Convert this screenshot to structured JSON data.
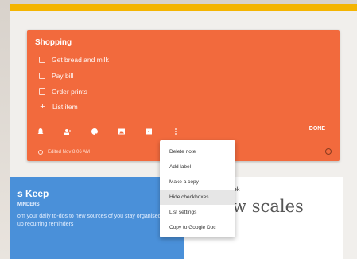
{
  "note": {
    "title": "Shopping",
    "items": [
      {
        "label": "Get bread and milk"
      },
      {
        "label": "Pay bill"
      },
      {
        "label": "Order prints"
      }
    ],
    "add_item_label": "List item",
    "toolbar_icons": [
      "reminder-icon",
      "collaborator-icon",
      "color-palette-icon",
      "image-icon",
      "archive-icon",
      "more-vert-icon"
    ],
    "done_label": "DONE",
    "edited_text": "Edited Nov 8:06 AM"
  },
  "menu": {
    "items": [
      {
        "label": "Delete note"
      },
      {
        "label": "Add label"
      },
      {
        "label": "Make a copy"
      },
      {
        "label": "Hide checkboxes",
        "active": true
      },
      {
        "label": "List settings"
      },
      {
        "label": "Copy to Google Doc"
      }
    ]
  },
  "left_card": {
    "title": "s Keep",
    "subtitle": "MINDERS",
    "text": "om your daily to-dos to new sources of   you stay organised. Set up recurring reminders"
  },
  "right_card": {
    "small_text": "week",
    "big_text": "n new scales"
  },
  "colors": {
    "note": "#f26a3d",
    "top_bar": "#f4b400",
    "left_card": "#4a90d9"
  }
}
